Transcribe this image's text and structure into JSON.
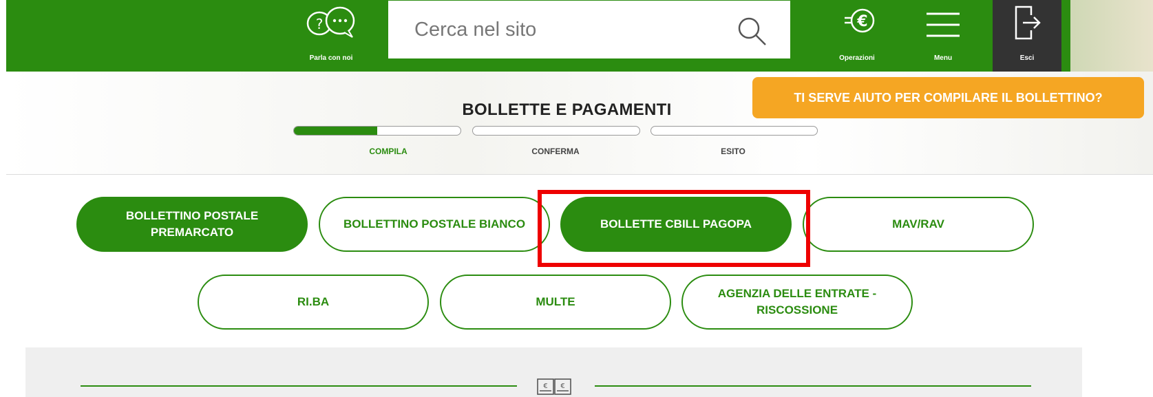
{
  "header": {
    "talk_label": "Parla con noi",
    "search_placeholder": "Cerca nel sito",
    "operations_label": "Operazioni",
    "menu_label": "Menu",
    "exit_label": "Esci"
  },
  "help": {
    "label": "TI SERVE AIUTO PER COMPILARE IL BOLLETTINO?"
  },
  "page": {
    "title": "BOLLETTE E PAGAMENTI"
  },
  "steps": [
    {
      "label": "COMPILA",
      "progress": 0.5,
      "color": "#2b8c10"
    },
    {
      "label": "CONFERMA",
      "progress": 0,
      "color": "#444444"
    },
    {
      "label": "ESITO",
      "progress": 0,
      "color": "#444444"
    }
  ],
  "payment_types": {
    "row1": [
      {
        "label": "BOLLETTINO POSTALE PREMARCATO",
        "active": true
      },
      {
        "label": "BOLLETTINO POSTALE BIANCO",
        "active": false
      },
      {
        "label": "BOLLETTE CBILL PAGOPA",
        "active": false,
        "highlighted": true
      },
      {
        "label": "MAV/RAV",
        "active": false
      }
    ],
    "row2": [
      {
        "label": "RI.BA",
        "active": false
      },
      {
        "label": "MULTE",
        "active": false
      },
      {
        "label": "AGENZIA DELLE ENTRATE - RISCOSSIONE",
        "active": false
      }
    ]
  },
  "colors": {
    "brand_green": "#2b8c10",
    "help_orange": "#f5a623",
    "highlight_red": "#ee0000",
    "exit_dark": "#333333"
  }
}
